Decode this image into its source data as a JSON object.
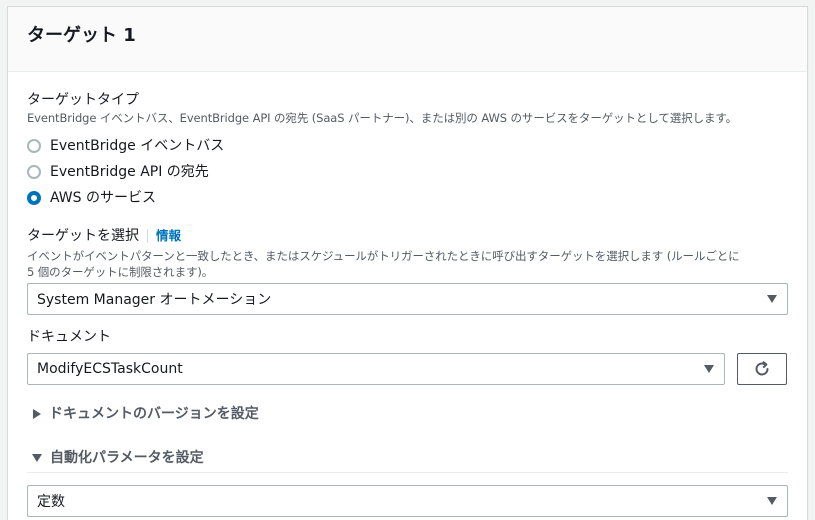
{
  "panel": {
    "title": "ターゲット 1"
  },
  "target_type": {
    "label": "ターゲットタイプ",
    "description": "EventBridge イベントバス、EventBridge API の宛先 (SaaS パートナー)、または別の AWS のサービスをターゲットとして選択します。",
    "options": [
      {
        "label": "EventBridge イベントバス",
        "selected": false
      },
      {
        "label": "EventBridge API の宛先",
        "selected": false
      },
      {
        "label": "AWS のサービス",
        "selected": true
      }
    ]
  },
  "select_target": {
    "label": "ターゲットを選択",
    "info_link": "情報",
    "description_line1": "イベントがイベントパターンと一致したとき、またはスケジュールがトリガーされたときに呼び出すターゲットを選択します (ルールごとに",
    "description_line2": "5 個のターゲットに制限されます)。",
    "value": "System Manager オートメーション"
  },
  "document": {
    "label": "ドキュメント",
    "value": "ModifyECSTaskCount",
    "refresh_icon": "refresh-icon"
  },
  "document_version": {
    "label": "ドキュメントのバージョンを設定",
    "expanded": false
  },
  "automation_params": {
    "label": "自動化パラメータを設定",
    "expanded": true,
    "value": "定数"
  },
  "colors": {
    "accent": "#0073bb",
    "text": "#16191f",
    "secondary_text": "#545b64",
    "border": "#aab7b8"
  }
}
